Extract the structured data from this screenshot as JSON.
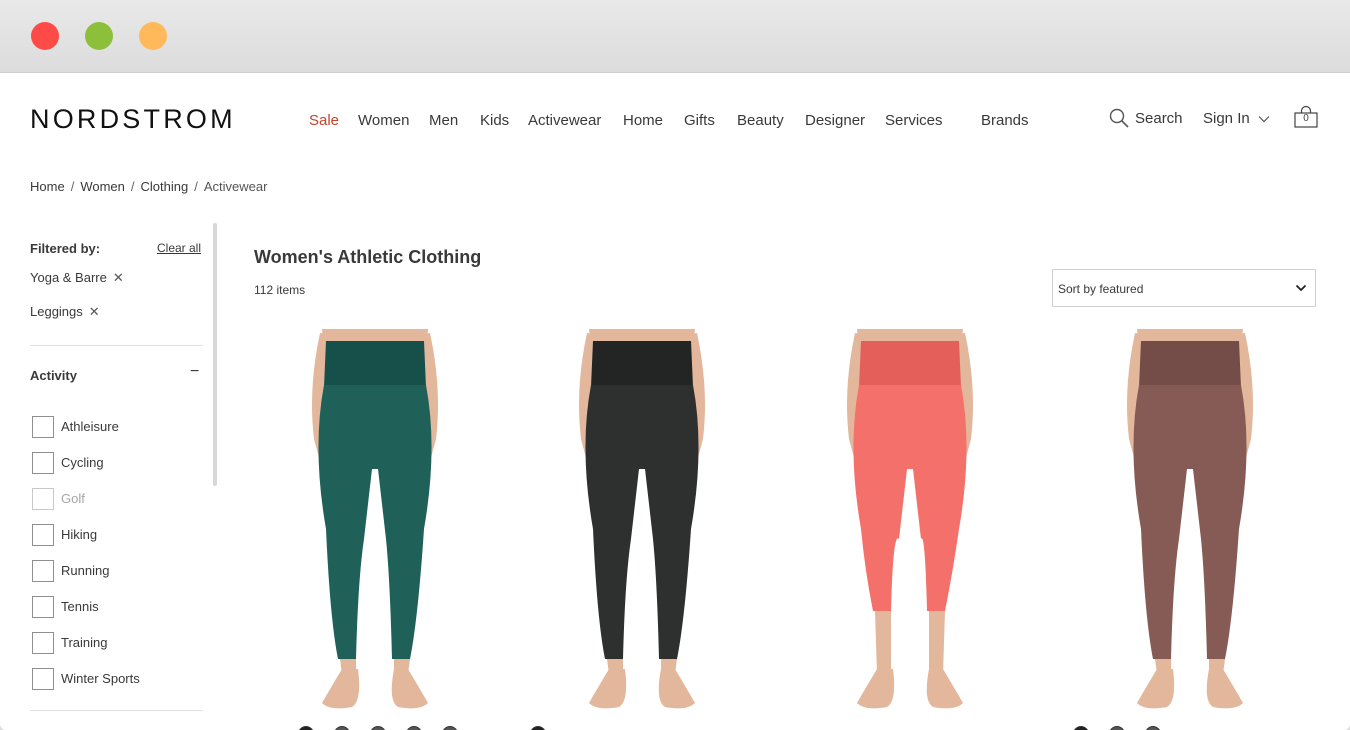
{
  "window": {
    "traffic_lights": [
      "#fe4b47",
      "#8dc03a",
      "#ffb95a"
    ]
  },
  "header": {
    "logo": "NORDSTROM",
    "nav": [
      "Sale",
      "Women",
      "Men",
      "Kids",
      "Activewear",
      "Home",
      "Gifts",
      "Beauty",
      "Designer",
      "Services",
      "Brands"
    ],
    "sale_color": "#c6422c",
    "search_label": "Search",
    "signin_label": "Sign In",
    "bag_count": "0"
  },
  "breadcrumb": [
    "Home",
    "Women",
    "Clothing",
    "Activewear"
  ],
  "filters": {
    "heading": "Filtered by:",
    "clear_label": "Clear all",
    "active": [
      "Yoga & Barre",
      "Leggings"
    ],
    "facet_title": "Activity",
    "facet_toggle": "−",
    "options": [
      {
        "label": "Athleisure",
        "disabled": false
      },
      {
        "label": "Cycling",
        "disabled": false
      },
      {
        "label": "Golf",
        "disabled": true
      },
      {
        "label": "Hiking",
        "disabled": false
      },
      {
        "label": "Running",
        "disabled": false
      },
      {
        "label": "Tennis",
        "disabled": false
      },
      {
        "label": "Training",
        "disabled": false
      },
      {
        "label": "Winter Sports",
        "disabled": false
      }
    ]
  },
  "main": {
    "title": "Women's Athletic Clothing",
    "count": "112 items",
    "sort": {
      "selected": "Sort by featured"
    }
  },
  "products": [
    {
      "color": "#1f6058",
      "shade": "#17504a"
    },
    {
      "color": "#2e2f2f",
      "shade": "#232424"
    },
    {
      "color": "#f4706a",
      "shade": "#e45f5a"
    },
    {
      "color": "#865b56",
      "shade": "#744c48"
    }
  ],
  "skin_color": "#e2b79c"
}
